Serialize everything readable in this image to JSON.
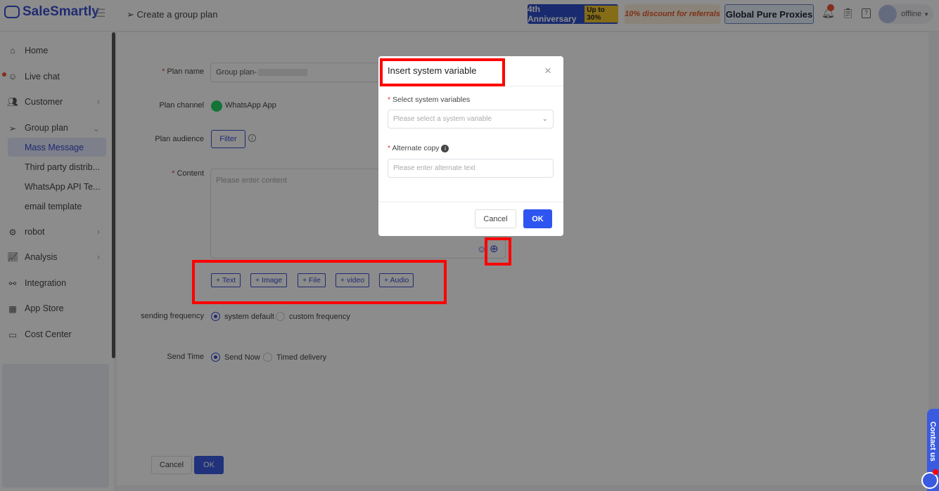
{
  "header": {
    "logo": "SaleSmartly",
    "breadcrumb": "Create a group plan",
    "banners": [
      "4th Anniversary",
      "Up to 30%",
      "10% discount for referrals",
      "Global Pure Proxies"
    ],
    "status": "offline"
  },
  "sidebar": {
    "items": [
      {
        "label": "Home"
      },
      {
        "label": "Live chat"
      },
      {
        "label": "Customer"
      },
      {
        "label": "Group plan"
      },
      {
        "label": "robot"
      },
      {
        "label": "Analysis"
      },
      {
        "label": "Integration"
      },
      {
        "label": "App Store"
      },
      {
        "label": "Cost Center"
      }
    ],
    "sub_items": [
      {
        "label": "Mass Message"
      },
      {
        "label": "Third party distrib..."
      },
      {
        "label": "WhatsApp API Te..."
      },
      {
        "label": "email template"
      }
    ]
  },
  "form": {
    "plan_name_label": "Plan name",
    "plan_name_value": "Group plan-",
    "plan_channel_label": "Plan channel",
    "plan_channel_value": "WhatsApp App",
    "plan_audience_label": "Plan audience",
    "filter_button": "Filter",
    "content_label": "Content",
    "content_placeholder": "Please enter content",
    "add_buttons": [
      "+ Text",
      "+ Image",
      "+ File",
      "+ video",
      "+ Audio"
    ],
    "sending_frequency_label": "sending frequency",
    "freq_options": [
      "system default",
      "custom frequency"
    ],
    "send_time_label": "Send Time",
    "time_options": [
      "Send Now",
      "Timed delivery"
    ],
    "cancel": "Cancel",
    "ok": "OK"
  },
  "modal": {
    "title": "Insert system variable",
    "select_label": "Select system variables",
    "select_placeholder": "Please select a system variable",
    "alt_label": "Alternate copy",
    "alt_placeholder": "Please enter alternate text",
    "cancel": "Cancel",
    "ok": "OK"
  },
  "contact": "Contact us"
}
